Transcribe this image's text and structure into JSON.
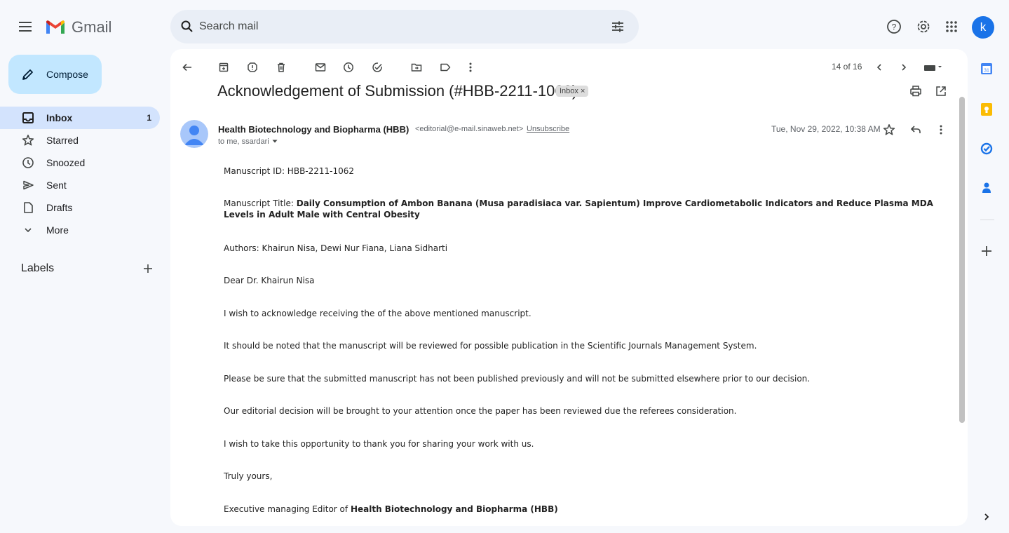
{
  "header": {
    "app_name": "Gmail",
    "search_placeholder": "Search mail",
    "avatar_letter": "k"
  },
  "sidebar": {
    "compose_label": "Compose",
    "items": [
      {
        "label": "Inbox",
        "count": "1",
        "icon": "inbox-icon"
      },
      {
        "label": "Starred",
        "icon": "star-icon"
      },
      {
        "label": "Snoozed",
        "icon": "clock-icon"
      },
      {
        "label": "Sent",
        "icon": "send-icon"
      },
      {
        "label": "Drafts",
        "icon": "draft-icon"
      },
      {
        "label": "More",
        "icon": "chevron-down-icon"
      }
    ],
    "labels_heading": "Labels"
  },
  "toolbar": {
    "pagination": "14 of 16"
  },
  "email": {
    "subject": "Acknowledgement of Submission (#HBB-2211-1062)",
    "label_chip": "Inbox ×",
    "sender_name": "Health Biotechnology and Biopharma (HBB)",
    "sender_email": "<editorial@e-mail.sinaweb.net>",
    "unsubscribe": "Unsubscribe",
    "recipients": "to me, ssardari",
    "date": "Tue, Nov 29, 2022, 10:38 AM",
    "body": {
      "manuscript_id": "Manuscript ID: HBB-2211-1062",
      "title_prefix": "Manuscript Title: ",
      "title": "Daily Consumption of Ambon Banana (Musa paradisiaca var. Sapientum) Improve Cardiometabolic Indicators and Reduce Plasma MDA Levels in Adult Male with Central Obesity",
      "authors": "Authors: Khairun Nisa, Dewi Nur Fiana, Liana Sidharti",
      "greeting": "Dear Dr. Khairun Nisa",
      "p1": "I wish to acknowledge receiving the of the above mentioned manuscript.",
      "p2": "It should be noted that the manuscript will be reviewed for possible publication in the Scientific Journals Management System.",
      "p3": "Please be sure that the submitted manuscript has not been published previously and will not be submitted elsewhere prior to our decision.",
      "p4": "Our editorial decision will be brought to your attention once the paper has been reviewed due the referees consideration.",
      "p5": "I wish to take this opportunity to thank you for sharing your work with us.",
      "closing": "Truly yours,",
      "signature_prefix": "Executive managing Editor of ",
      "signature_org": "Health Biotechnology and Biopharma (HBB)"
    }
  },
  "colors": {
    "accent": "#1a73e8",
    "compose_bg": "#c2e7ff",
    "active_nav_bg": "#d3e3fd",
    "page_bg": "#f6f8fc"
  }
}
